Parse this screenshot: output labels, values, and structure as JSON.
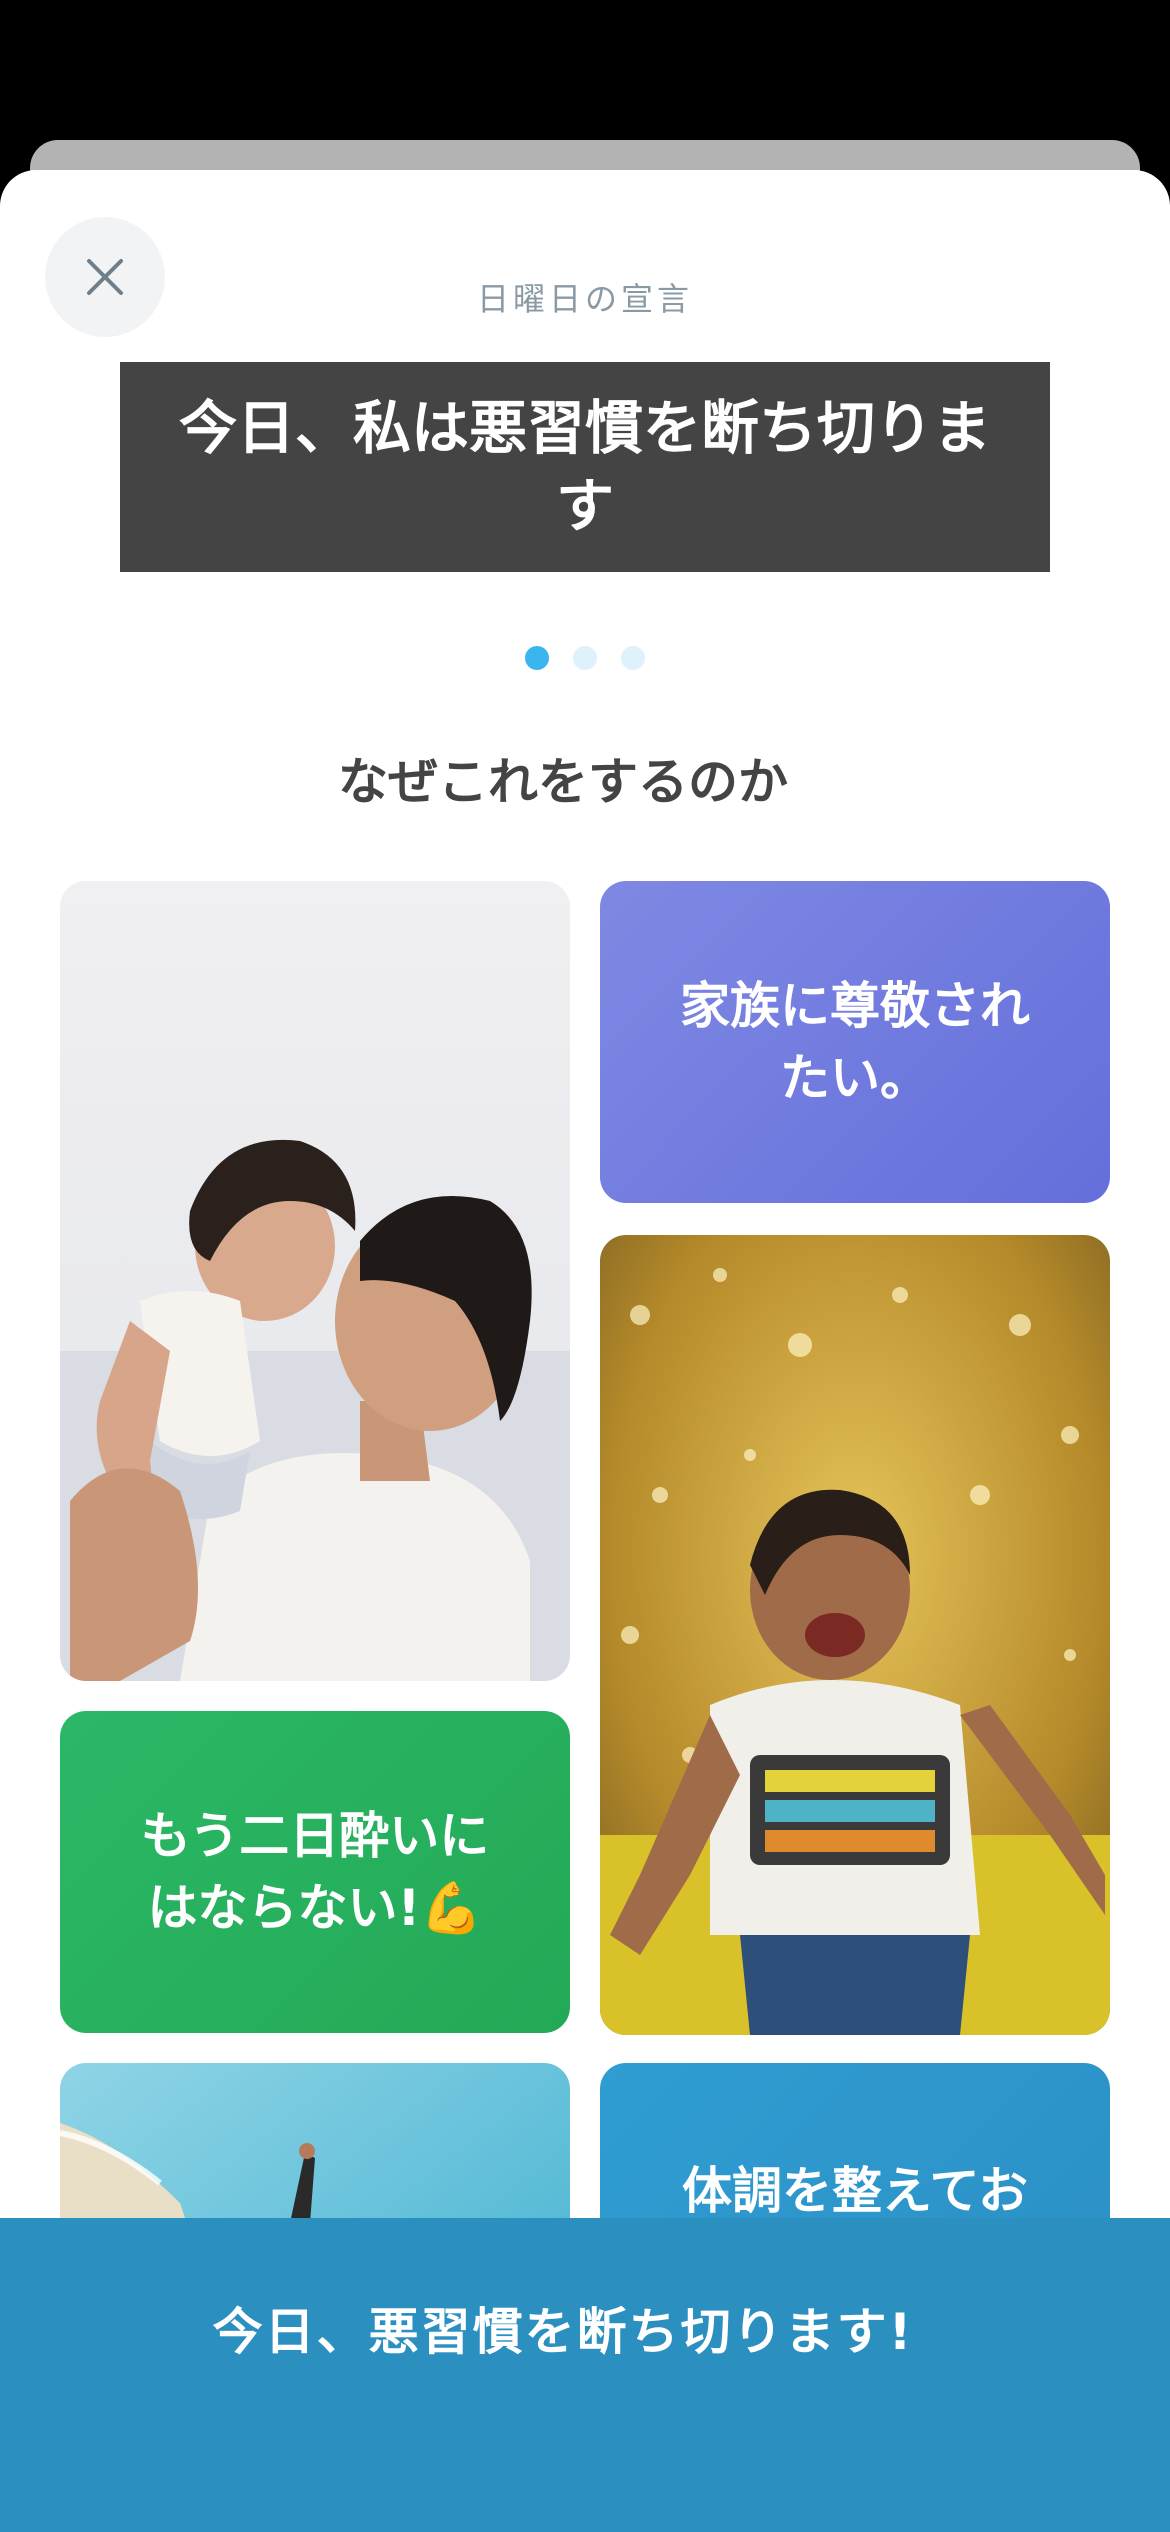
{
  "header": {
    "subtitle": "日曜日の宣言",
    "headline": "今日、私は悪習慣を断ち切ります",
    "close_icon": "close-icon"
  },
  "pager": {
    "total": 3,
    "active_index": 0,
    "active_color": "#3bb5ef",
    "inactive_color": "#dff1fb"
  },
  "section": {
    "title": "なぜこれをするのか"
  },
  "reasons": {
    "respect": {
      "text": "家族に尊敬されたい。",
      "color": "#6b78de"
    },
    "no_hangover": {
      "text": "もう二日酔いにはならない!💪",
      "color": "#27b15f"
    },
    "health": {
      "text": "体調を整えてお",
      "color": "#2f96cc"
    }
  },
  "cta": {
    "label": "今日、悪習慣を断ち切ります!",
    "color": "#2b8fc0"
  }
}
